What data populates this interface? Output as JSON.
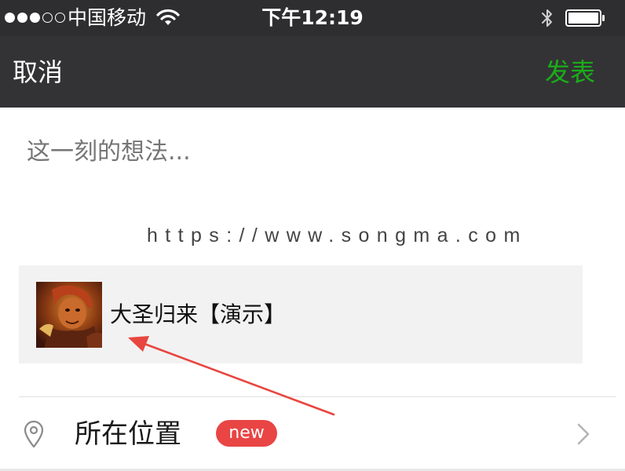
{
  "status_bar": {
    "carrier": "中国移动",
    "time": "下午12:19",
    "signal_bars_filled": 3,
    "signal_bars_total": 5
  },
  "nav": {
    "cancel_label": "取消",
    "post_label": "发表"
  },
  "compose": {
    "placeholder": "这一刻的想法..."
  },
  "watermark_text": "https://www.songma.com",
  "link_card": {
    "title": "大圣归来【演示】"
  },
  "location": {
    "label": "所在位置",
    "badge": "new"
  },
  "colors": {
    "accent_green": "#1aad19",
    "badge_red": "#e94545",
    "arrow_red": "#e8463f",
    "nav_background": "#333335"
  },
  "icons": {
    "wifi": "wifi-icon",
    "bluetooth": "bluetooth-icon",
    "battery": "battery-icon",
    "location": "location-pin-icon",
    "chevron": "chevron-right-icon"
  }
}
